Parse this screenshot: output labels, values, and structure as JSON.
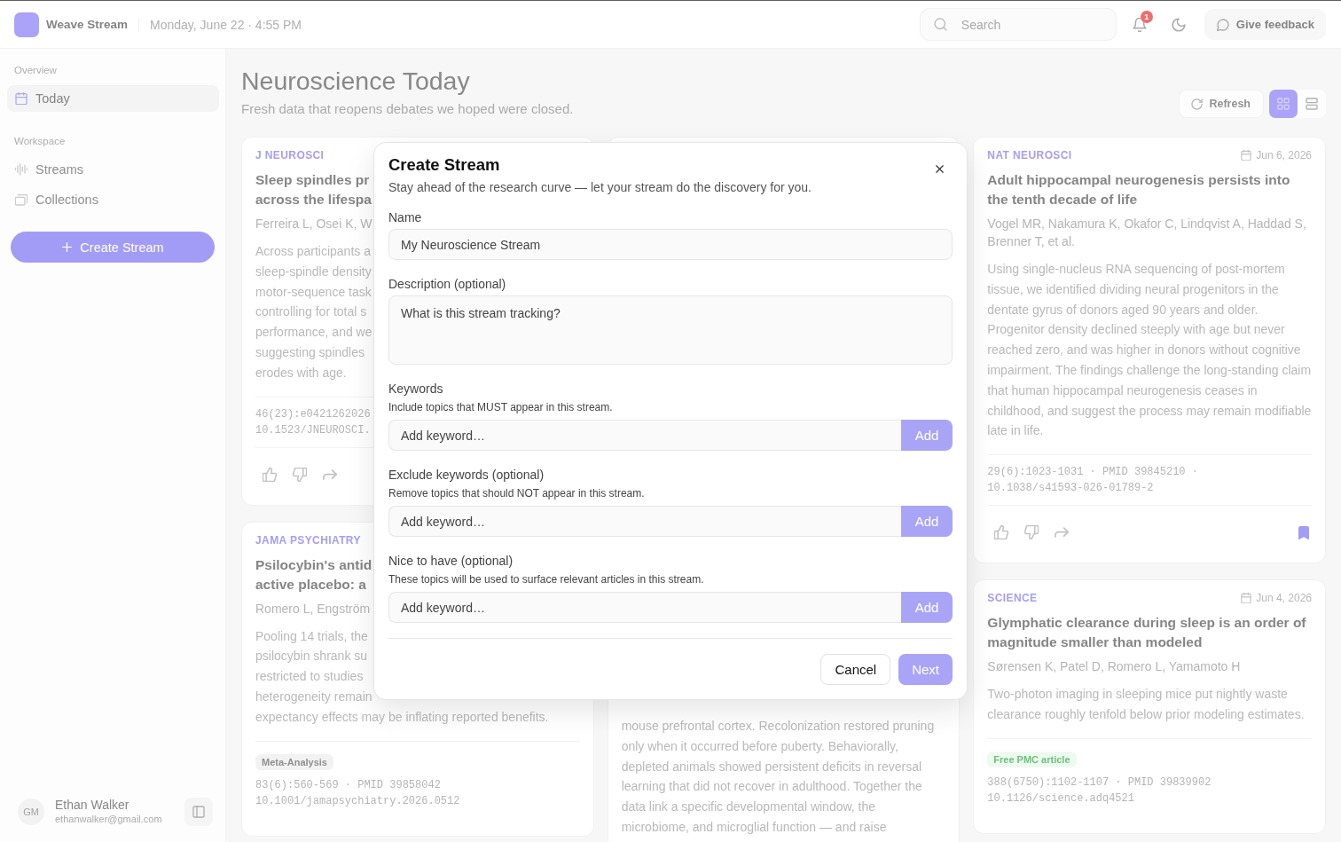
{
  "topbar": {
    "app_name": "Weave Stream",
    "datetime": "Monday, June 22 · 4:55 PM",
    "search": {
      "placeholder": "Search"
    },
    "notification_count": "1",
    "feedback_button": "Give feedback"
  },
  "sidebar": {
    "sections": [
      {
        "title": "Overview",
        "items": [
          {
            "label": "Today",
            "selected": true
          }
        ]
      },
      {
        "title": "Workspace",
        "items": [
          {
            "label": "Streams",
            "selected": false
          },
          {
            "label": "Collections",
            "selected": false
          }
        ]
      }
    ],
    "create_button": "Create Stream",
    "user": {
      "initials": "GM",
      "name": "Ethan Walker",
      "email": "ethanwalker@gmail.com"
    }
  },
  "header": {
    "title": "Neuroscience Today",
    "subtitle": "Fresh data that reopens debates we hoped were closed.",
    "refresh_button": "Refresh",
    "view_options": [
      {
        "selected": true
      },
      {
        "selected": false
      }
    ]
  },
  "feed": {
    "columns": [
      {
        "cards": [
          {
            "kind": "clipped",
            "journal": "J NEUROSCI",
            "title_lines": [
              "Sleep spindles pr",
              "across the lifespa"
            ],
            "authors": "Ferreira L, Osei K, W",
            "abstract_lines": [
              "Across participants a",
              "sleep-spindle density",
              "motor-sequence task",
              "controlling for total s",
              "performance, and we",
              "suggesting spindles",
              "erodes with age."
            ],
            "meta_lines": [
              "46(23):e0421262026",
              "10.1523/JNEUROSCI."
            ],
            "actions_visible": true
          },
          {
            "kind": "clipped",
            "journal": "JAMA PSYCHIATRY",
            "title_lines": [
              "Psilocybin's antid",
              "active placebo: a"
            ],
            "authors": "Romero L, Engström",
            "abstract_lines": [
              "Pooling 14 trials, the",
              "psilocybin shrank su",
              "restricted to studies",
              "heterogeneity remain",
              "expectancy effects may be inflating reported benefits."
            ],
            "tags": [
              {
                "label": "Meta-Analysis",
                "kind": "type"
              }
            ],
            "meta_lines": [
              "83(6):560-569 · PMID 39858042",
              "10.1001/jamapsychiatry.2026.0512"
            ],
            "actions_visible": false
          }
        ]
      },
      {
        "cards": [
          {
            "kind": "covered",
            "abstract_lines": [
              "mouse prefrontal cortex. Recolonization restored pruning",
              "only when it occurred before puberty. Behaviorally,",
              "depleted animals showed persistent deficits in reversal",
              "learning that did not recover in adulthood. Together the",
              "data link a specific developmental window, the",
              "microbiome, and microglial function — and raise"
            ],
            "actions_visible": false
          }
        ]
      },
      {
        "cards": [
          {
            "kind": "full",
            "journal": "NAT NEUROSCI",
            "date": "Jun 6, 2026",
            "title": "Adult hippocampal neurogenesis persists into the tenth decade of life",
            "authors": "Vogel MR, Nakamura K, Okafor C, Lindqvist A, Haddad S, Brenner T, et al.",
            "abstract": "Using single-nucleus RNA sequencing of post-mortem tissue, we identified dividing neural progenitors in the dentate gyrus of donors aged 90 years and older. Progenitor density declined steeply with age but never reached zero, and was higher in donors without cognitive impairment. The findings challenge the long-standing claim that human hippocampal neurogenesis ceases in childhood, and suggest the process may remain modifiable late in life.",
            "meta_lines": [
              "29(6):1023-1031 · PMID 39845210 ·",
              "10.1038/s41593-026-01789-2"
            ],
            "actions_visible": true,
            "bookmarked": true
          },
          {
            "kind": "full",
            "journal": "SCIENCE",
            "date": "Jun 4, 2026",
            "title": "Glymphatic clearance during sleep is an order of magnitude smaller than modeled",
            "authors": "Sørensen K, Patel D, Romero L, Yamamoto H",
            "abstract": "Two-photon imaging in sleeping mice put nightly waste clearance roughly tenfold below prior modeling estimates.",
            "tags": [
              {
                "label": "Free PMC article",
                "kind": "access"
              }
            ],
            "meta_lines": [
              "388(6750):1102-1107 · PMID 39839902",
              "10.1126/science.adq4521"
            ],
            "actions_visible": false
          }
        ]
      }
    ]
  },
  "dialog": {
    "title": "Create Stream",
    "subtitle": "Stay ahead of the research curve — let your stream do the discovery for you.",
    "fields": [
      {
        "kind": "text",
        "label": "Name",
        "placeholder": "My Neuroscience Stream"
      },
      {
        "kind": "textarea",
        "label": "Description (optional)",
        "placeholder": "What is this stream tracking?"
      },
      {
        "kind": "keywords",
        "label": "Keywords",
        "hint": "Include topics that MUST appear in this stream.",
        "placeholder": "Add keyword…",
        "button": "Add"
      },
      {
        "kind": "keywords",
        "label": "Exclude keywords (optional)",
        "hint": "Remove topics that should NOT appear in this stream.",
        "placeholder": "Add keyword…",
        "button": "Add"
      },
      {
        "kind": "keywords",
        "label": "Nice to have (optional)",
        "hint": "These topics will be used to surface relevant articles in this stream.",
        "placeholder": "Add keyword…",
        "button": "Add"
      }
    ],
    "buttons": [
      {
        "label": "Cancel",
        "kind": "secondary"
      },
      {
        "label": "Next",
        "kind": "primary"
      }
    ]
  }
}
